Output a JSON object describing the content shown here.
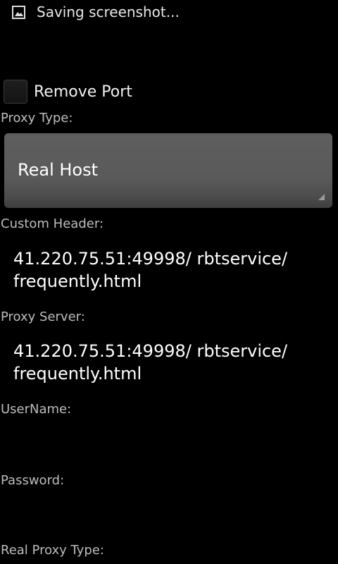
{
  "status_bar": {
    "icon": "image-icon",
    "text": "Saving screenshot..."
  },
  "remove_port": {
    "label": "Remove Port",
    "checked": false
  },
  "proxy_type": {
    "label": "Proxy Type:",
    "selected": "Real Host"
  },
  "custom_header": {
    "label": "Custom Header:",
    "value_line1": "41.220.75.51:49998/ rbtservice/",
    "value_line2": "frequently.html"
  },
  "proxy_server": {
    "label": "Proxy Server:",
    "value_line1": "41.220.75.51:49998/ rbtservice/",
    "value_line2": "frequently.html"
  },
  "username": {
    "label": "UserName:",
    "value": ""
  },
  "password": {
    "label": "Password:",
    "value": ""
  },
  "real_proxy_type": {
    "label": "Real Proxy Type:"
  }
}
